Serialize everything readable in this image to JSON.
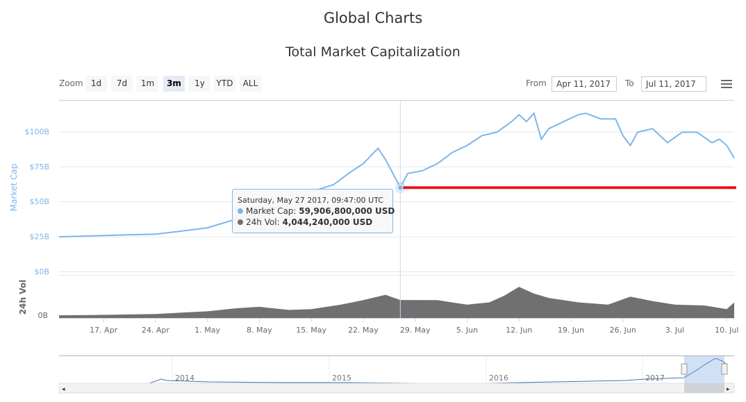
{
  "page_title": "Global Charts",
  "chart_title": "Total Market Capitalization",
  "zoom": {
    "label": "Zoom",
    "buttons": [
      "1d",
      "7d",
      "1m",
      "3m",
      "1y",
      "YTD",
      "ALL"
    ],
    "selected": "3m"
  },
  "range": {
    "from_label": "From",
    "from": "Apr 11, 2017",
    "to_label": "To",
    "to": "Jul 11, 2017"
  },
  "colors": {
    "market_cap": "#7cb5ec",
    "volume": "#707070",
    "annotation": "#e8141e"
  },
  "tooltip": {
    "date": "Saturday, May 27 2017, 09:47:00 UTC",
    "market_cap_label": "Market Cap:",
    "market_cap_value": "59,906,800,000 USD",
    "vol_label": "24h Vol:",
    "vol_value": "4,044,240,000 USD"
  },
  "chart_data": {
    "type": "line",
    "x_range": [
      "2017-04-11",
      "2017-07-11"
    ],
    "x_ticks": [
      "17. Apr",
      "24. Apr",
      "1. May",
      "8. May",
      "15. May",
      "22. May",
      "29. May",
      "5. Jun",
      "12. Jun",
      "19. Jun",
      "26. Jun",
      "3. Jul",
      "10. Jul"
    ],
    "market_cap": {
      "axis_label": "Market Cap",
      "unit": "B USD",
      "ylim": [
        0,
        122
      ],
      "ticks": [
        "$0B",
        "$25B",
        "$50B",
        "$75B",
        "$100B"
      ],
      "points": [
        [
          "2017-04-11",
          24.8
        ],
        [
          "2017-04-14",
          25.2
        ],
        [
          "2017-04-17",
          25.7
        ],
        [
          "2017-04-20",
          26.2
        ],
        [
          "2017-04-24",
          26.7
        ],
        [
          "2017-04-27",
          28.5
        ],
        [
          "2017-05-01",
          31.2
        ],
        [
          "2017-05-04",
          36
        ],
        [
          "2017-05-08",
          42
        ],
        [
          "2017-05-11",
          48
        ],
        [
          "2017-05-15",
          57
        ],
        [
          "2017-05-18",
          62
        ],
        [
          "2017-05-20",
          70
        ],
        [
          "2017-05-22",
          77
        ],
        [
          "2017-05-24",
          88
        ],
        [
          "2017-05-25",
          80
        ],
        [
          "2017-05-26",
          70
        ],
        [
          "2017-05-27",
          59.9
        ],
        [
          "2017-05-28",
          70
        ],
        [
          "2017-05-30",
          72
        ],
        [
          "2017-06-01",
          77
        ],
        [
          "2017-06-03",
          85
        ],
        [
          "2017-06-05",
          90
        ],
        [
          "2017-06-07",
          97
        ],
        [
          "2017-06-09",
          99.5
        ],
        [
          "2017-06-11",
          107
        ],
        [
          "2017-06-12",
          112
        ],
        [
          "2017-06-13",
          107
        ],
        [
          "2017-06-14",
          113
        ],
        [
          "2017-06-15",
          94.5
        ],
        [
          "2017-06-16",
          102
        ],
        [
          "2017-06-18",
          107
        ],
        [
          "2017-06-20",
          112
        ],
        [
          "2017-06-21",
          113
        ],
        [
          "2017-06-23",
          109
        ],
        [
          "2017-06-25",
          109
        ],
        [
          "2017-06-26",
          97
        ],
        [
          "2017-06-27",
          90
        ],
        [
          "2017-06-28",
          99.5
        ],
        [
          "2017-06-30",
          102
        ],
        [
          "2017-07-02",
          92
        ],
        [
          "2017-07-04",
          99.5
        ],
        [
          "2017-07-06",
          99.5
        ],
        [
          "2017-07-08",
          92
        ],
        [
          "2017-07-09",
          94.5
        ],
        [
          "2017-07-10",
          90
        ],
        [
          "2017-07-11",
          81
        ]
      ]
    },
    "volume": {
      "axis_label": "24h Vol",
      "unit": "B USD",
      "ylim": [
        0,
        9.5
      ],
      "ticks": [
        "0B"
      ],
      "points": [
        [
          "2017-04-11",
          0.6
        ],
        [
          "2017-04-17",
          0.7
        ],
        [
          "2017-04-24",
          0.9
        ],
        [
          "2017-05-01",
          1.5
        ],
        [
          "2017-05-05",
          2.2
        ],
        [
          "2017-05-08",
          2.5
        ],
        [
          "2017-05-12",
          1.8
        ],
        [
          "2017-05-15",
          2
        ],
        [
          "2017-05-19",
          3
        ],
        [
          "2017-05-22",
          4
        ],
        [
          "2017-05-25",
          5.2
        ],
        [
          "2017-05-27",
          4.04
        ],
        [
          "2017-06-01",
          4
        ],
        [
          "2017-06-05",
          3
        ],
        [
          "2017-06-08",
          3.5
        ],
        [
          "2017-06-10",
          5
        ],
        [
          "2017-06-12",
          7
        ],
        [
          "2017-06-14",
          5.5
        ],
        [
          "2017-06-16",
          4.5
        ],
        [
          "2017-06-20",
          3.5
        ],
        [
          "2017-06-24",
          3
        ],
        [
          "2017-06-27",
          4.8
        ],
        [
          "2017-06-30",
          3.8
        ],
        [
          "2017-07-03",
          3
        ],
        [
          "2017-07-07",
          2.8
        ],
        [
          "2017-07-10",
          2
        ],
        [
          "2017-07-11",
          3.5
        ]
      ]
    },
    "reference_line": {
      "value": 59.9,
      "from": "2017-05-27",
      "to": "2017-07-11"
    },
    "crosshair": "2017-05-27",
    "navigator": {
      "labels": [
        "2014",
        "2015",
        "2016",
        "2017"
      ]
    }
  }
}
